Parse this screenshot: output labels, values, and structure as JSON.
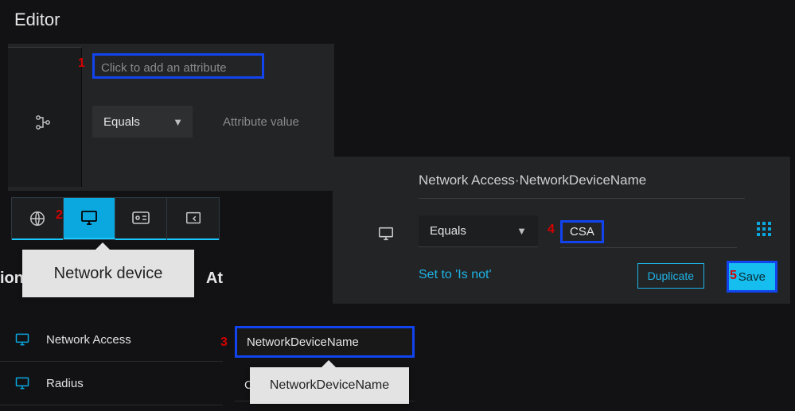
{
  "editor": {
    "title": "Editor",
    "attribute_placeholder": "Click to add an attribute",
    "operator": "Equals",
    "value_placeholder": "Attribute value"
  },
  "markers": {
    "m1": "1",
    "m2": "2",
    "m3": "3",
    "m4": "4",
    "m5": "5"
  },
  "tabs": {
    "tooltip": "Network device",
    "items": [
      {
        "name": "globe"
      },
      {
        "name": "monitor",
        "active": true
      },
      {
        "name": "device-card"
      },
      {
        "name": "chat-box"
      }
    ]
  },
  "partial_header": {
    "left": "ion",
    "right": "At"
  },
  "categories": [
    {
      "icon": "monitor",
      "label": "Network Access"
    },
    {
      "icon": "monitor",
      "label": "Radius"
    }
  ],
  "attribute_list": {
    "selected": "NetworkDeviceName",
    "tooltip": "NetworkDeviceName",
    "peek_char": "C"
  },
  "condition": {
    "title": "Network Access·NetworkDeviceName",
    "operator": "Equals",
    "value": "CSA",
    "is_not": "Set to 'Is not'",
    "duplicate": "Duplicate",
    "save": "Save"
  }
}
